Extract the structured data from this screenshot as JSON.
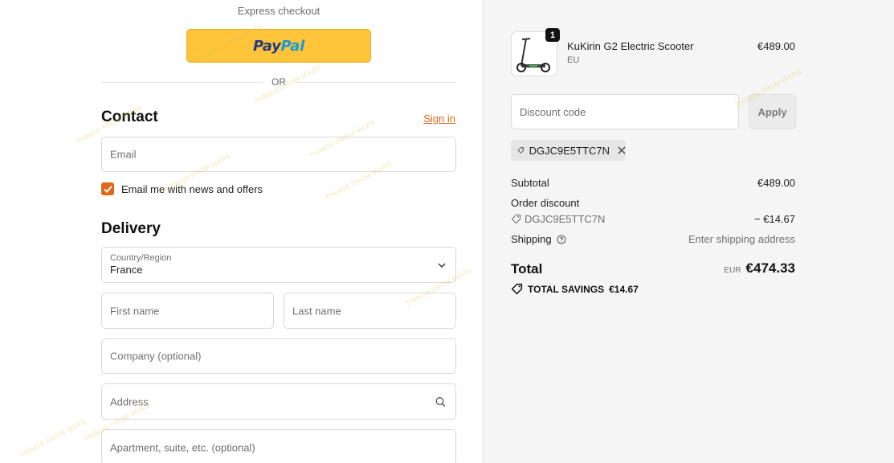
{
  "express": {
    "label": "Express checkout",
    "paypal_part1": "Pay",
    "paypal_part2": "Pal"
  },
  "divider": {
    "or_text": "OR"
  },
  "contact": {
    "title": "Contact",
    "signin_label": "Sign in",
    "email_placeholder": "Email",
    "newsletter_label": "Email me with news and offers",
    "newsletter_checked": true
  },
  "delivery": {
    "title": "Delivery",
    "country_label": "Country/Region",
    "country_value": "France",
    "first_name_placeholder": "First name",
    "last_name_placeholder": "Last name",
    "company_placeholder": "Company (optional)",
    "address_placeholder": "Address",
    "apartment_placeholder": "Apartment, suite, etc. (optional)"
  },
  "summary": {
    "product": {
      "name": "KuKirin G2 Electric Scooter",
      "variant": "EU",
      "price": "€489.00",
      "quantity": "1"
    },
    "discount": {
      "placeholder": "Discount code",
      "apply_label": "Apply",
      "applied_code": "DGJC9E5TTC7N"
    },
    "subtotal_label": "Subtotal",
    "subtotal_value": "€489.00",
    "order_discount_label": "Order discount",
    "order_discount_code": "DGJC9E5TTC7N",
    "order_discount_value": "− €14.67",
    "shipping_label": "Shipping",
    "shipping_value": "Enter shipping address",
    "total_label": "Total",
    "total_currency": "EUR",
    "total_value": "€474.33",
    "savings_label": "TOTAL SAVINGS",
    "savings_value": "€14.67"
  },
  "colors": {
    "accent": "#e0671a",
    "paypal_yellow": "#ffc439",
    "panel_bg": "#f5f5f5"
  },
  "watermark": "THINGS FROM MARS"
}
